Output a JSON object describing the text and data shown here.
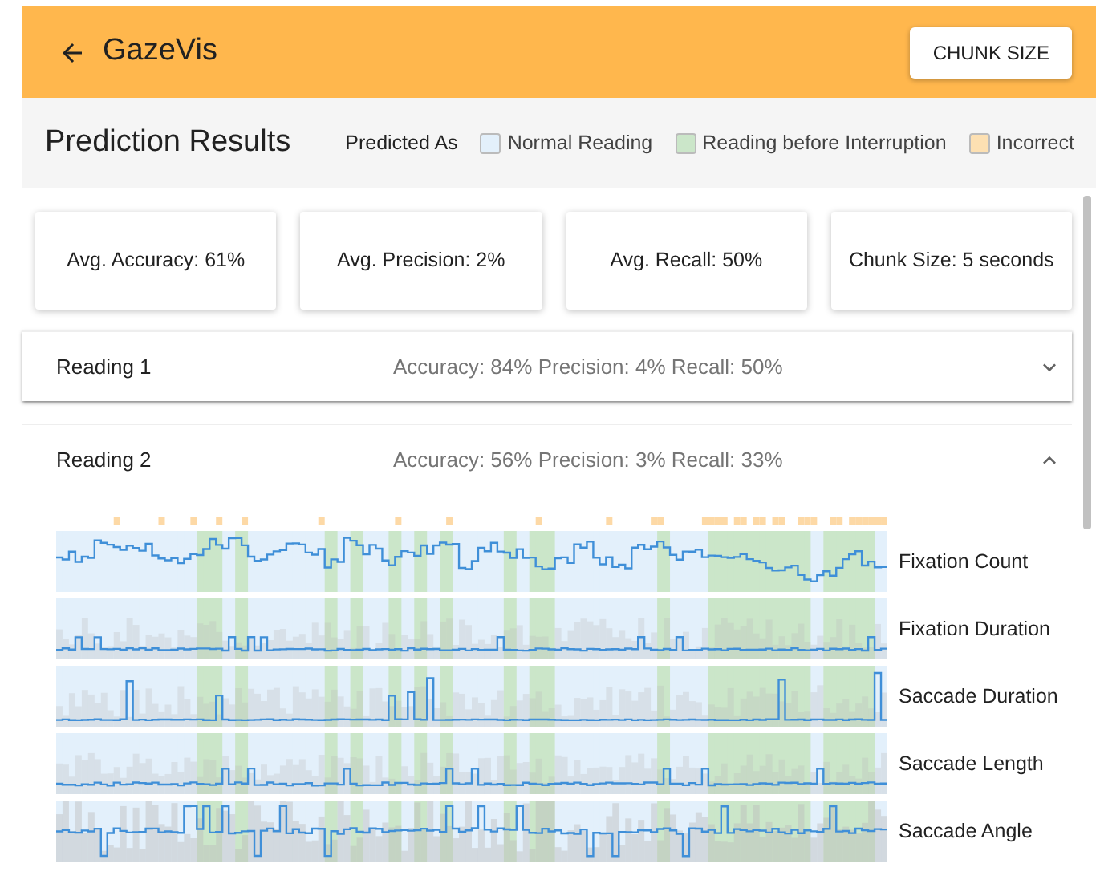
{
  "app_bar": {
    "title": "GazeVis",
    "button": "CHUNK SIZE"
  },
  "header": {
    "title": "Prediction Results",
    "legend_label": "Predicted As",
    "legend": [
      {
        "label": "Normal Reading",
        "color": "#e3f0fb"
      },
      {
        "label": "Reading before Interruption",
        "color": "#cbe6c9"
      },
      {
        "label": "Incorrect",
        "color": "#fde0b2"
      }
    ]
  },
  "stats": [
    "Avg. Accuracy: 61%",
    "Avg. Precision: 2%",
    "Avg. Recall: 50%",
    "Chunk Size: 5 seconds"
  ],
  "readings": [
    {
      "title": "Reading 1",
      "metrics": "Accuracy: 84% Precision: 4% Recall: 50%",
      "expanded": false
    },
    {
      "title": "Reading 2",
      "metrics": "Accuracy: 56% Precision: 3% Recall: 33%",
      "expanded": true,
      "features": [
        "Fixation Count",
        "Fixation Duration",
        "Saccade Duration",
        "Saccade Length",
        "Saccade Angle"
      ]
    }
  ]
}
